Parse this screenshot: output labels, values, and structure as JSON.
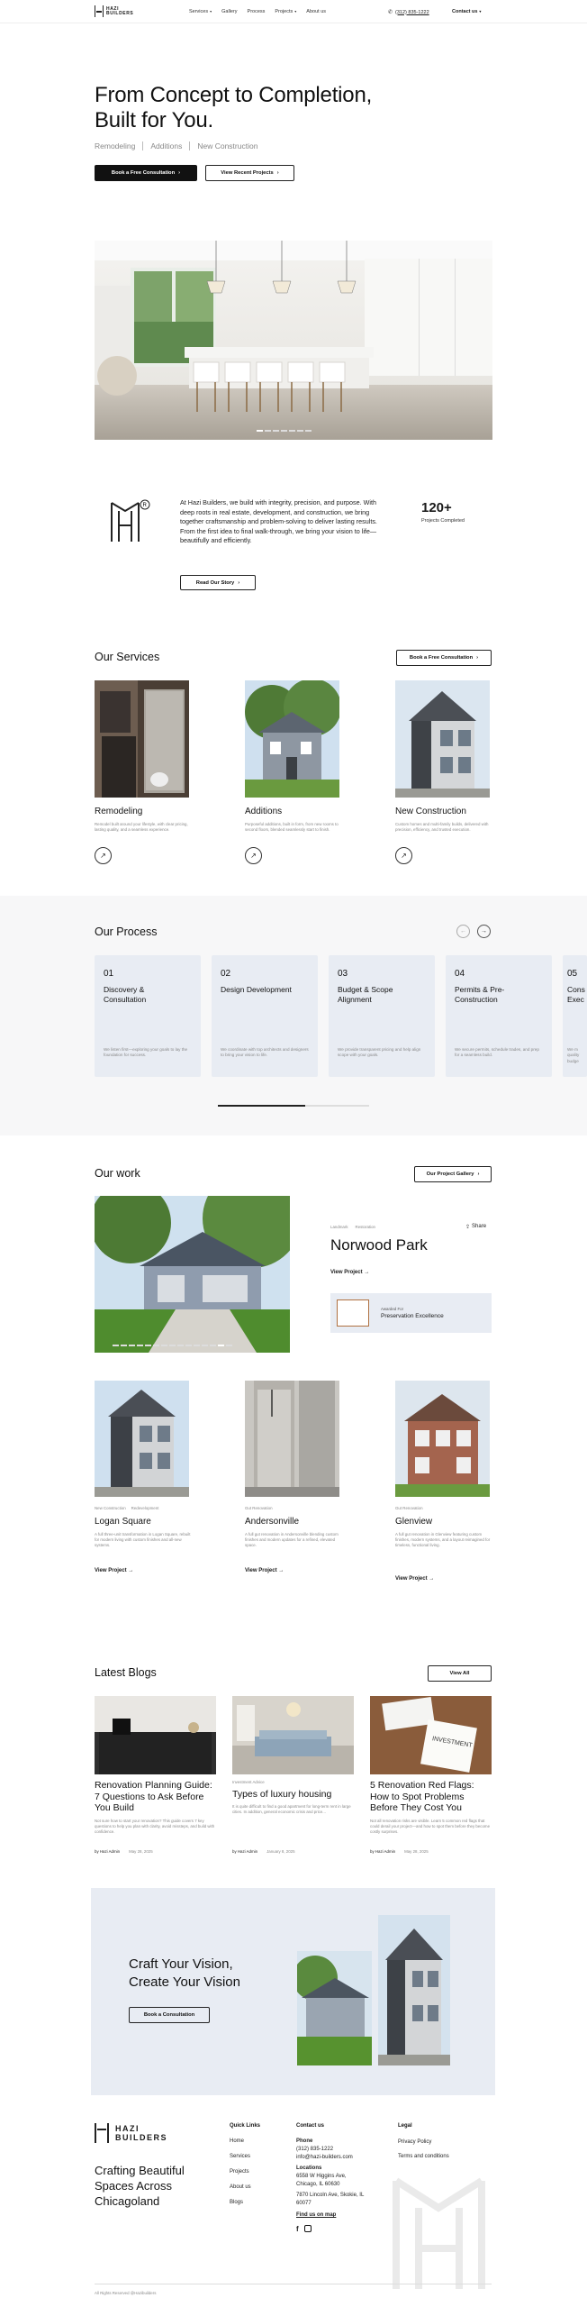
{
  "header": {
    "brand_line1": "HAZI",
    "brand_line2": "BUILDERS",
    "nav": [
      "Services",
      "Gallery",
      "Process",
      "Projects",
      "About us"
    ],
    "phone": "(312) 835-1222",
    "contact": "Contact us"
  },
  "hero": {
    "title_line1": "From Concept to Completion,",
    "title_line2": "Built for You.",
    "tags": [
      "Remodeling",
      "Additions",
      "New Construction"
    ],
    "primary_btn": "Book a Free Consultation",
    "secondary_btn": "View Recent Projects"
  },
  "about": {
    "text": "At Hazi Builders, we build with integrity, precision, and purpose. With deep roots in real estate, development, and construction, we bring together craftsmanship and problem-solving to deliver lasting results. From the first idea to final walk-through, we bring your vision to life—beautifully and efficiently.",
    "button": "Read Our Story",
    "stat_value": "120+",
    "stat_label": "Projects Completed"
  },
  "services": {
    "title": "Our Services",
    "button": "Book a Free Consultation",
    "items": [
      {
        "title": "Remodeling",
        "desc": "Remodel built around your lifestyle, with clear pricing, lasting quality, and a seamless experience."
      },
      {
        "title": "Additions",
        "desc": "Purposeful additions, built in form, from new rooms to second floors, blended seamlessly start to finish."
      },
      {
        "title": "New Construction",
        "desc": "Custom homes and multi-family builds, delivered with precision, efficiency, and trusted execution."
      }
    ]
  },
  "process": {
    "title": "Our Process",
    "steps": [
      {
        "num": "01",
        "title": "Discovery & Consultation",
        "desc": "We listen first—exploring your goals to lay the foundation for success."
      },
      {
        "num": "02",
        "title": "Design Development",
        "desc": "We coordinate with top architects and designers to bring your vision to life."
      },
      {
        "num": "03",
        "title": "Budget & Scope Alignment",
        "desc": "We provide transparent pricing and help align scope with your goals."
      },
      {
        "num": "04",
        "title": "Permits & Pre-Construction",
        "desc": "We secure permits, schedule trades, and prep for a seamless build."
      },
      {
        "num": "05",
        "title": "Cons Exec",
        "desc": "We m quality budge"
      }
    ]
  },
  "work": {
    "title": "Our work",
    "button": "Our Project Gallery",
    "featured": {
      "tags": [
        "Landmark",
        "Restoration"
      ],
      "share": "Share",
      "title": "Norwood Park",
      "link": "View Project",
      "award_label": "Awarded For",
      "award_title": "Preservation Excellence"
    },
    "cards": [
      {
        "tags": [
          "New Construction",
          "Redevelopment"
        ],
        "title": "Logan Square",
        "desc": "A full three-unit transformation in Logan Square, rebuilt for modern living with custom finishes and all-new systems.",
        "link": "View Project"
      },
      {
        "tags": [
          "Gut Renovation"
        ],
        "title": "Andersonville",
        "desc": "A full gut renovation in Andersonville blending custom finishes and modern updates for a refined, elevated space.",
        "link": "View Project"
      },
      {
        "tags": [
          "Gut Renovation"
        ],
        "title": "Glenview",
        "desc": "A full gut renovation in Glenview featuring custom finishes, modern systems, and a layout reimagined for timeless, functional living.",
        "link": "View Project"
      }
    ]
  },
  "blogs": {
    "title": "Latest Blogs",
    "button": "View All",
    "items": [
      {
        "tag": "",
        "title": "Renovation Planning Guide: 7 Questions to Ask Before You Build",
        "desc": "Not sure how to start your renovation? This guide covers 7 key questions to help you plan with clarity, avoid missteps, and build with confidence.",
        "author": "by Hazi Admin",
        "date": "May 28, 2025"
      },
      {
        "tag": "Investment Advice",
        "title": "Types of luxury housing",
        "desc": "It is quite difficult to find a good apartment for long-term rent in large cities. In addition, general economic crisis and price...",
        "author": "by Hazi Admin",
        "date": "January 8, 2025"
      },
      {
        "tag": "",
        "title": "5 Renovation Red Flags: How to Spot Problems Before They Cost You",
        "desc": "Not all renovation risks are visible. Learn 5 common red flags that could derail your project—and how to spot them before they become costly surprises.",
        "author": "by Hazi Admin",
        "date": "May 28, 2025"
      }
    ]
  },
  "cta": {
    "title_line1": "Craft Your Vision,",
    "title_line2": "Create Your Vision",
    "button": "Book a Consultation"
  },
  "footer": {
    "tagline": "Crafting Beautiful Spaces Across Chicagoland",
    "quick_links_title": "Quick Links",
    "quick_links": [
      "Home",
      "Services",
      "Projects",
      "About us",
      "Blogs"
    ],
    "contact_title": "Contact us",
    "phone_label": "Phone",
    "phone": "(312) 835-1222",
    "email": "info@hazi-builders.com",
    "locations_label": "Locations",
    "loc1": "6558 W Higgins Ave, Chicago, IL 60630",
    "loc2": "7870 Lincoln Ave, Skokie, IL 60077",
    "find_us": "Find us on map",
    "legal_title": "Legal",
    "legal": [
      "Privacy Policy",
      "Terms and conditions"
    ],
    "copyright": "All Rights Reserved @Hazibuilders"
  }
}
